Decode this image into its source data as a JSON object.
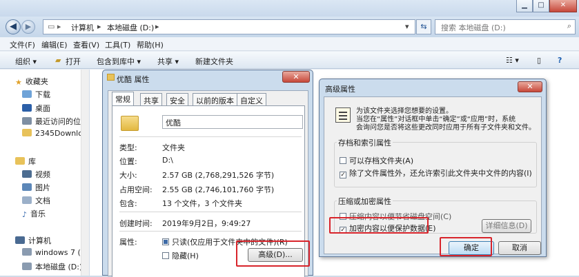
{
  "window": {
    "minimize": "▁",
    "maximize": "□",
    "close": "✕"
  },
  "address": {
    "back": "◀",
    "forward": "▶",
    "crumbs": [
      "计算机",
      "本地磁盘 (D:)"
    ],
    "search_placeholder": "搜索 本地磁盘 (D:)"
  },
  "menu": [
    "文件(F)",
    "编辑(E)",
    "查看(V)",
    "工具(T)",
    "帮助(H)"
  ],
  "toolbar": [
    "组织 ▾",
    "打开",
    "包含到库中 ▾",
    "共享 ▾",
    "新建文件夹"
  ],
  "nav": {
    "favorites": {
      "header": "收藏夹",
      "items": [
        "下载",
        "桌面",
        "最近访问的位置",
        "2345Downloa"
      ]
    },
    "libraries": {
      "header": "库",
      "items": [
        "视频",
        "图片",
        "文档",
        "音乐"
      ]
    },
    "computer": {
      "header": "计算机",
      "items": [
        "windows 7 (C:",
        "本地磁盘 (D:)"
      ]
    }
  },
  "props": {
    "title": "优酷 属性",
    "close": "✕",
    "tabs": [
      "常规",
      "共享",
      "安全",
      "以前的版本",
      "自定义"
    ],
    "name": "优酷",
    "rows": [
      {
        "label": "类型:",
        "value": "文件夹"
      },
      {
        "label": "位置:",
        "value": "D:\\"
      },
      {
        "label": "大小:",
        "value": "2.57 GB (2,768,291,526 字节)"
      },
      {
        "label": "占用空间:",
        "value": "2.55 GB (2,746,101,760 字节)"
      },
      {
        "label": "包含:",
        "value": "13 个文件，3 个文件夹"
      },
      {
        "label": "创建时间:",
        "value": "2019年9月2日，9:49:27"
      }
    ],
    "attr_label": "属性:",
    "readonly": "只读(仅应用于文件夹中的文件)(R)",
    "hidden": "隐藏(H)",
    "advanced_button": "高级(D)..."
  },
  "adv": {
    "title": "高级属性",
    "close": "✕",
    "desc1": "为该文件夹选择您想要的设置。",
    "desc2": "当您在“属性”对话框中单击“确定”或“应用”时，系统",
    "desc3": "会询问您是否将这些更改同时应用于所有子文件夹和文件。",
    "archive_group": "存档和索引属性",
    "archive_opt": "可以存档文件夹(A)",
    "index_opt": "除了文件属性外，还允许索引此文件夹中文件的内容(I)",
    "compress_group": "压缩或加密属性",
    "compress_opt": "压缩内容以便节省磁盘空间(C)",
    "encrypt_opt": "加密内容以便保护数据(E)",
    "details_button": "详细信息(D)",
    "ok_button": "确定",
    "cancel_button": "取消"
  }
}
